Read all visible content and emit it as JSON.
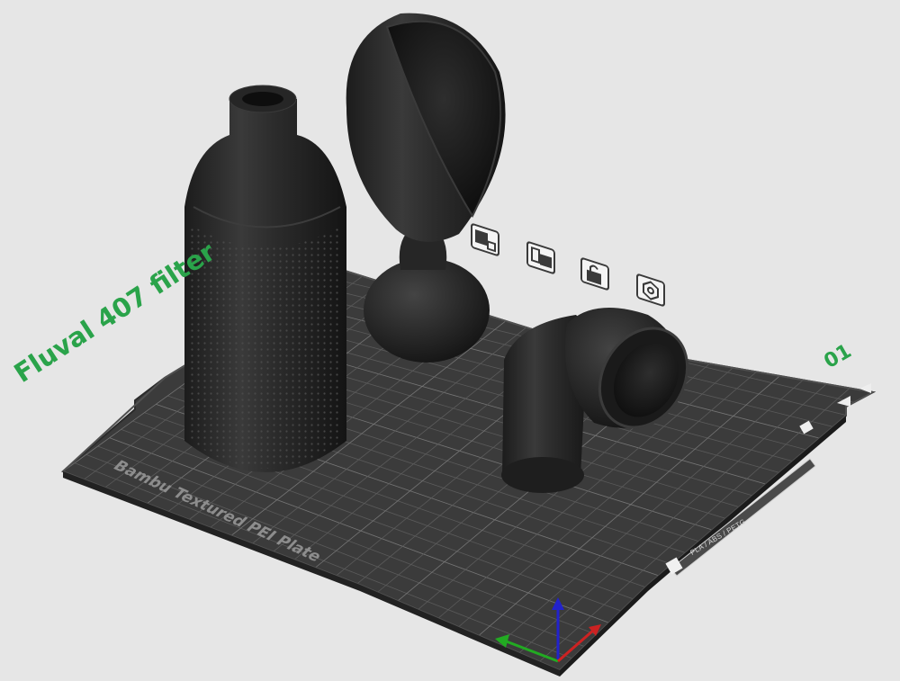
{
  "plate": {
    "name": "Fluval 407 filter",
    "number": "01",
    "label": "Bambu Textured PEI Plate",
    "filament_tag": "PLA / ABS / PETG"
  },
  "plate_toolbar": [
    {
      "name": "arrange-icon",
      "tooltip": "Arrange"
    },
    {
      "name": "orient-icon",
      "tooltip": "Auto orient"
    },
    {
      "name": "lock-icon",
      "tooltip": "Lock plate"
    },
    {
      "name": "plate-settings-icon",
      "tooltip": "Plate settings"
    }
  ],
  "colors": {
    "background": "#e6e6e6",
    "plate": "#3b3b3b",
    "grid": "#6a6a6a",
    "accent_green": "#2aa34a",
    "axis_x": "#cc2222",
    "axis_y": "#22aa22",
    "axis_z": "#2222cc",
    "model": "#2a2a2a"
  }
}
